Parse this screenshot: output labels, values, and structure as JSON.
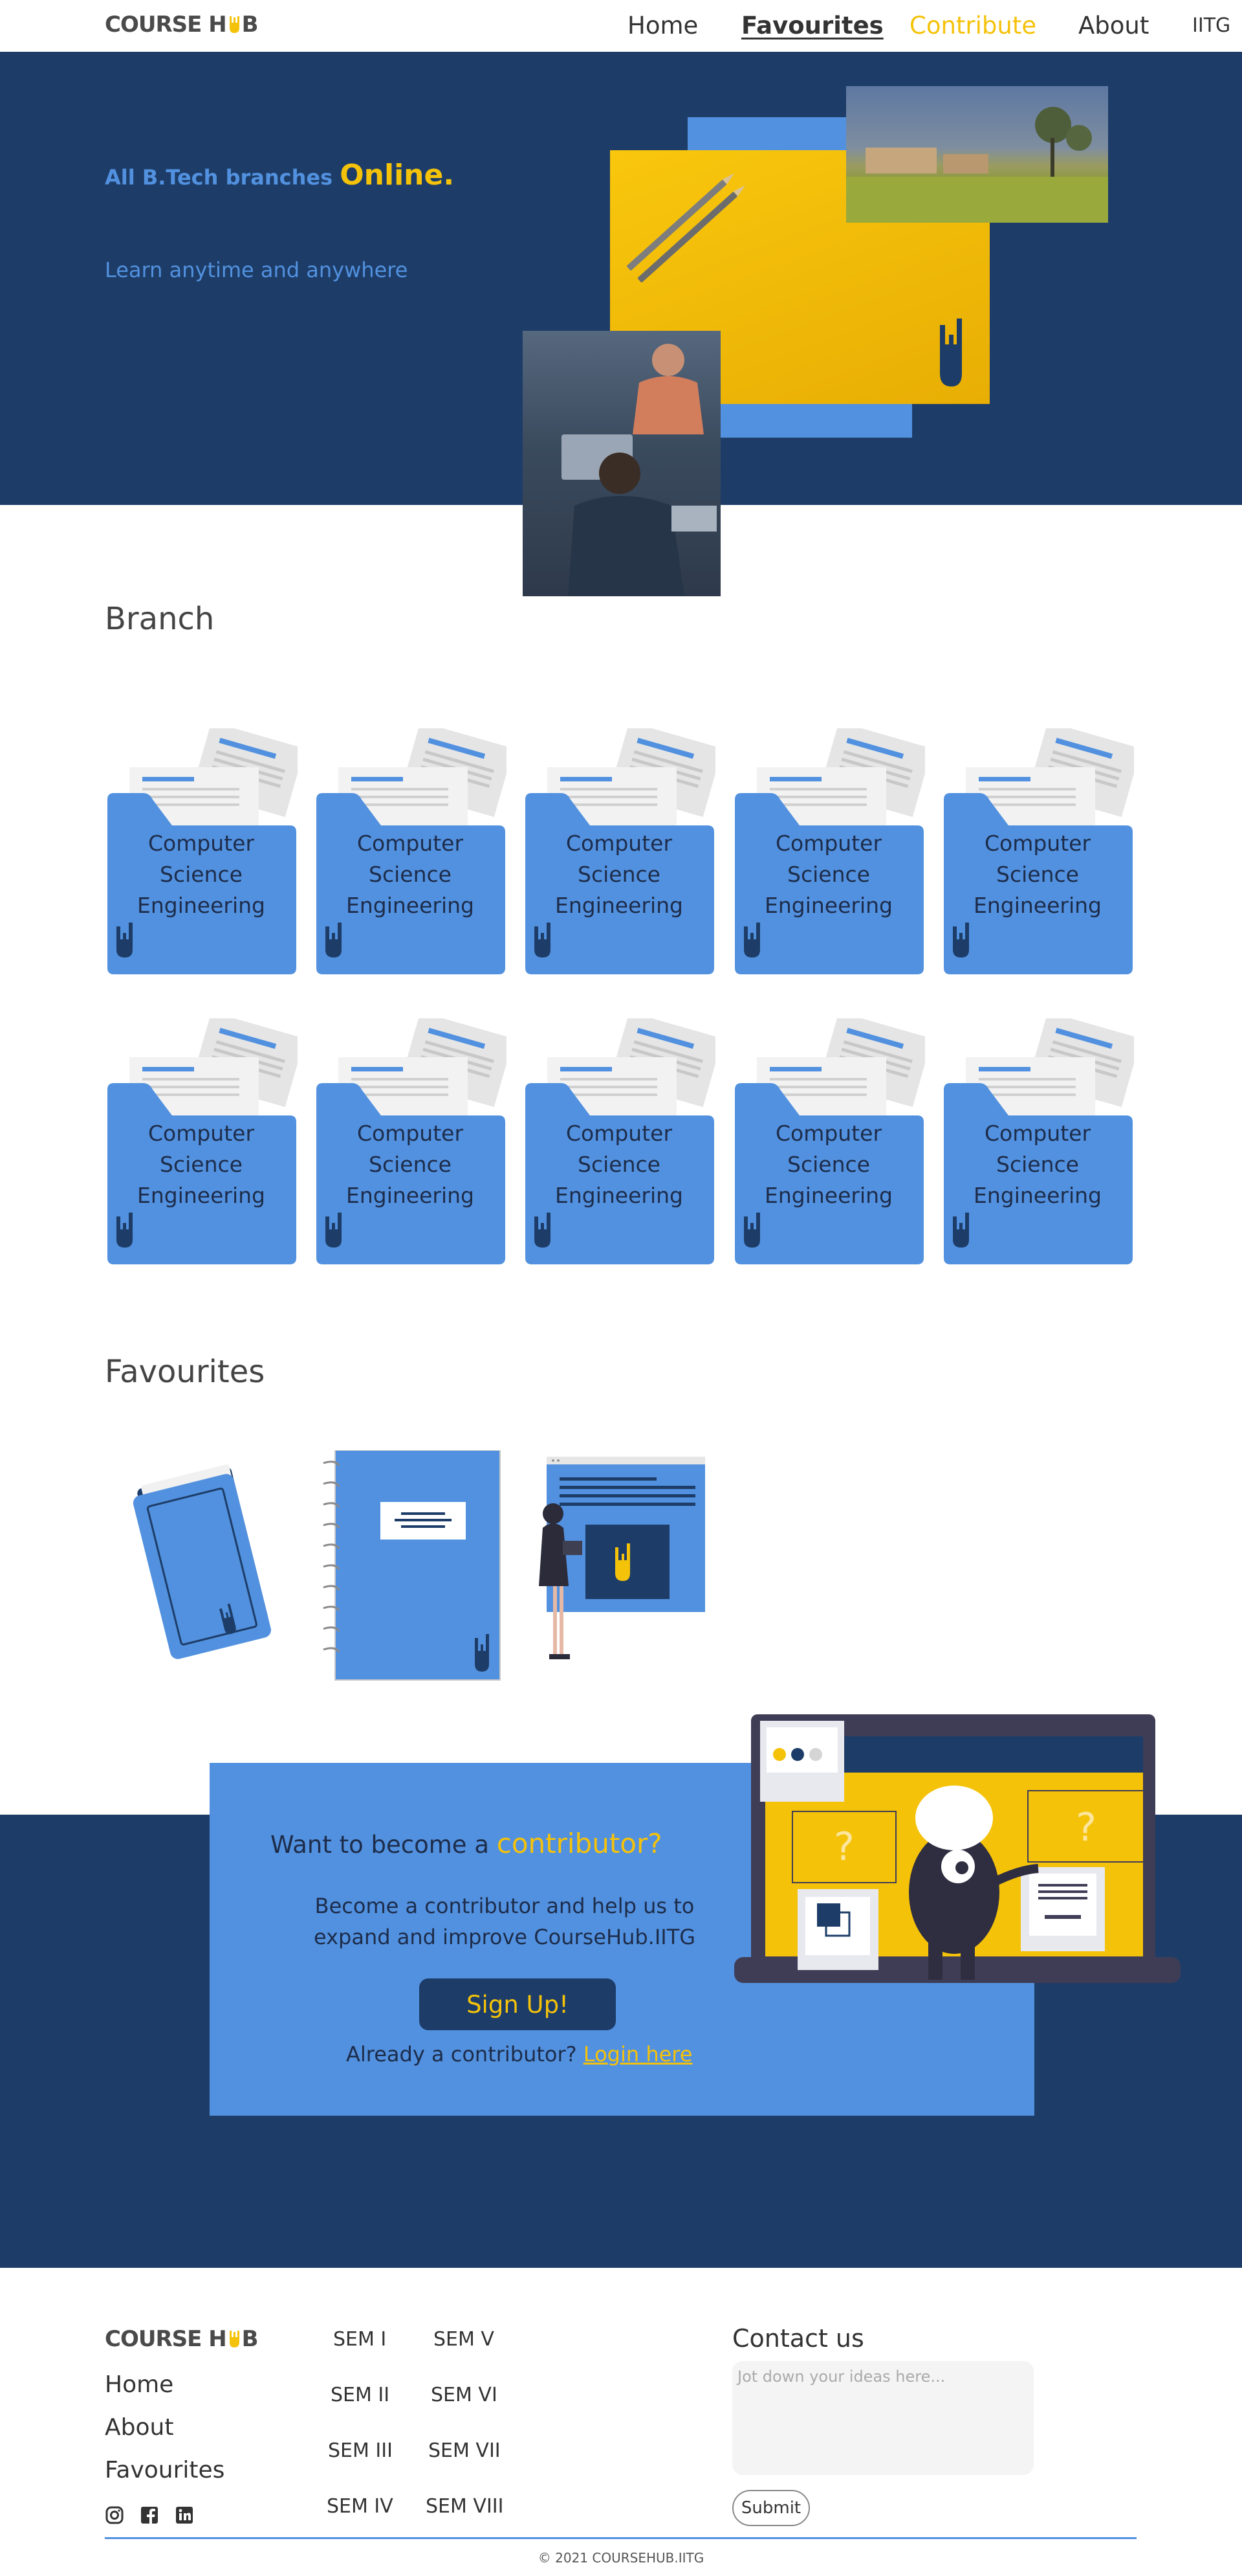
{
  "brand": {
    "logo_left": "COURSE H",
    "logo_right": "B"
  },
  "nav": {
    "home": "Home",
    "favourites": "Favourites",
    "contribute": "Contribute",
    "about": "About",
    "iitg": "IITG"
  },
  "hero": {
    "line1_a": "All B.Tech branches ",
    "line1_b": "Online.",
    "line2": "Learn anytime and anywhere"
  },
  "branch": {
    "title": "Branch",
    "items": [
      {
        "l1": "Computer",
        "l2": "Science",
        "l3": "Engineering"
      },
      {
        "l1": "Computer",
        "l2": "Science",
        "l3": "Engineering"
      },
      {
        "l1": "Computer",
        "l2": "Science",
        "l3": "Engineering"
      },
      {
        "l1": "Computer",
        "l2": "Science",
        "l3": "Engineering"
      },
      {
        "l1": "Computer",
        "l2": "Science",
        "l3": "Engineering"
      },
      {
        "l1": "Computer",
        "l2": "Science",
        "l3": "Engineering"
      },
      {
        "l1": "Computer",
        "l2": "Science",
        "l3": "Engineering"
      },
      {
        "l1": "Computer",
        "l2": "Science",
        "l3": "Engineering"
      },
      {
        "l1": "Computer",
        "l2": "Science",
        "l3": "Engineering"
      },
      {
        "l1": "Computer",
        "l2": "Science",
        "l3": "Engineering"
      }
    ]
  },
  "favourites": {
    "title": "Favourites"
  },
  "contribute": {
    "title_a": "Want to become a ",
    "title_b": "contributor?",
    "desc": "Become a contributor and help us to expand and improve CourseHub.IITG",
    "signup": "Sign Up!",
    "already": "Already a contributor? ",
    "login": "Login here"
  },
  "footer": {
    "links": {
      "home": "Home",
      "about": "About",
      "favourites": "Favourites"
    },
    "sems": [
      "SEM I",
      "SEM V",
      "SEM II",
      "SEM VI",
      "SEM III",
      "SEM VII",
      "SEM IV",
      "SEM VIII"
    ],
    "contact_title": "Contact us",
    "contact_placeholder": "Jot down your ideas here...",
    "submit": "Submit",
    "copyright": "© 2021 COURSEHUB.IITG"
  },
  "colors": {
    "navy": "#1d3d68",
    "blue": "#5291df",
    "yellow": "#f5c20a",
    "dark": "#1d2c4a"
  },
  "icons": [
    "rock-hand-icon",
    "instagram-icon",
    "facebook-icon",
    "linkedin-icon"
  ]
}
